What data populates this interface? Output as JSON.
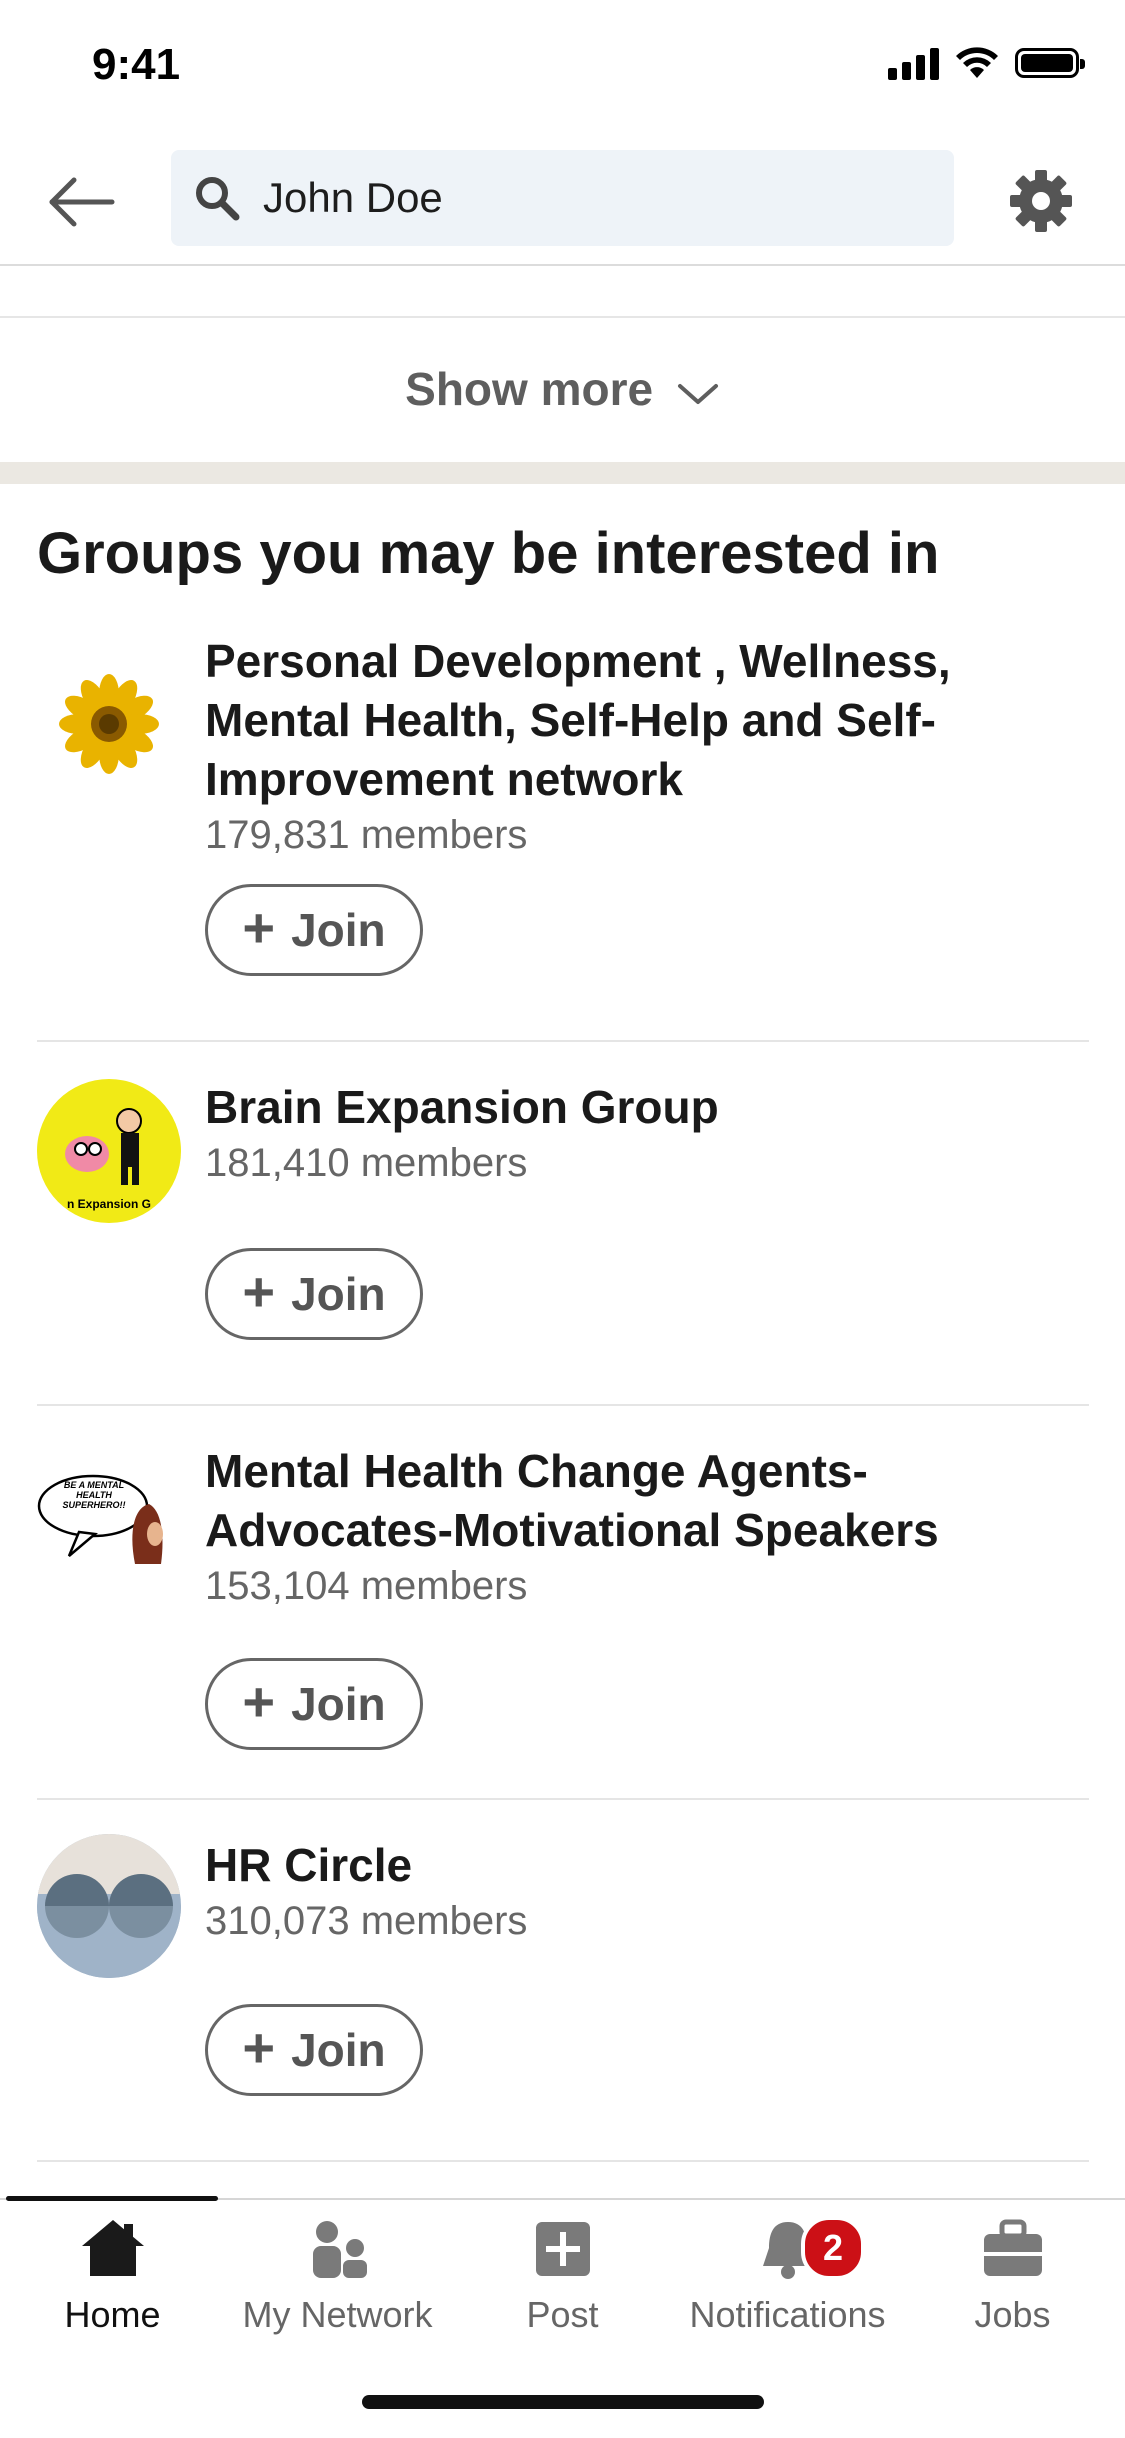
{
  "status_bar": {
    "time": "9:41"
  },
  "search": {
    "query": "John Doe"
  },
  "show_more": {
    "label": "Show more"
  },
  "section": {
    "title": "Groups you may be interested in"
  },
  "groups": [
    {
      "name": "Personal Development , Wellness, Mental Health, Self-Help and Self-Improvement network",
      "members": "179,831 members",
      "join_label": "Join",
      "logo": "sunflower"
    },
    {
      "name": "Brain Expansion Group",
      "members": "181,410 members",
      "join_label": "Join",
      "logo": "brain-expansion",
      "logo_text": "n Expansion G"
    },
    {
      "name": "Mental Health Change Agents-Advocates-Motivational Speakers",
      "members": "153,104 members",
      "join_label": "Join",
      "logo": "mental-health-superhero",
      "logo_text": "BE A MENTAL HEALTH SUPERHERO!!"
    },
    {
      "name": "HR Circle",
      "members": "310,073 members",
      "join_label": "Join",
      "logo": "hr-circle"
    }
  ],
  "bottom_nav": {
    "items": [
      {
        "label": "Home",
        "icon": "home-icon",
        "active": true
      },
      {
        "label": "My Network",
        "icon": "people-icon"
      },
      {
        "label": "Post",
        "icon": "plus-square-icon"
      },
      {
        "label": "Notifications",
        "icon": "bell-icon",
        "badge": "2"
      },
      {
        "label": "Jobs",
        "icon": "briefcase-icon"
      }
    ]
  },
  "colors": {
    "accent_badge": "#cc1016",
    "search_bg": "#eef3f8",
    "band": "#ebe8e2"
  }
}
